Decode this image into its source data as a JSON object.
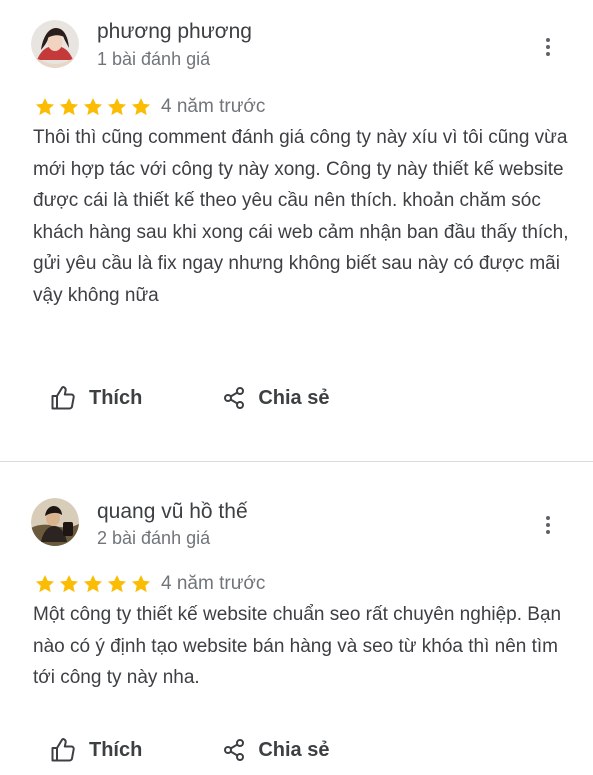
{
  "colors": {
    "star": "#fbbc04",
    "text": "#3c4043",
    "meta": "#70757a",
    "divider": "#dadce0"
  },
  "reviews": [
    {
      "author": "phương phương",
      "review_count": "1 bài đánh giá",
      "rating": 5,
      "time": "4 năm trước",
      "text": "Thôi thì cũng comment đánh giá công ty này xíu vì tôi cũng vừa mới hợp tác với công ty này xong. Công ty này thiết kế website được cái là thiết kế theo yêu cầu nên thích. khoản chăm sóc khách hàng sau khi xong cái web cảm nhận ban đầu thấy thích, gửi yêu cầu là fix ngay nhưng không biết sau này có được mãi vậy không nữa",
      "like_label": "Thích",
      "share_label": "Chia sẻ",
      "avatar_icon": "avatar-photo",
      "more_icon": "more-vert-icon"
    },
    {
      "author": "quang vũ hồ thế",
      "review_count": "2 bài đánh giá",
      "rating": 5,
      "time": "4 năm trước",
      "text": "Một công ty thiết kế website chuẩn seo rất chuyên nghiệp. Bạn nào có ý định tạo website bán hàng và seo từ khóa thì nên tìm tới công ty này nha.",
      "like_label": "Thích",
      "share_label": "Chia sẻ",
      "avatar_icon": "avatar-photo",
      "more_icon": "more-vert-icon"
    }
  ]
}
